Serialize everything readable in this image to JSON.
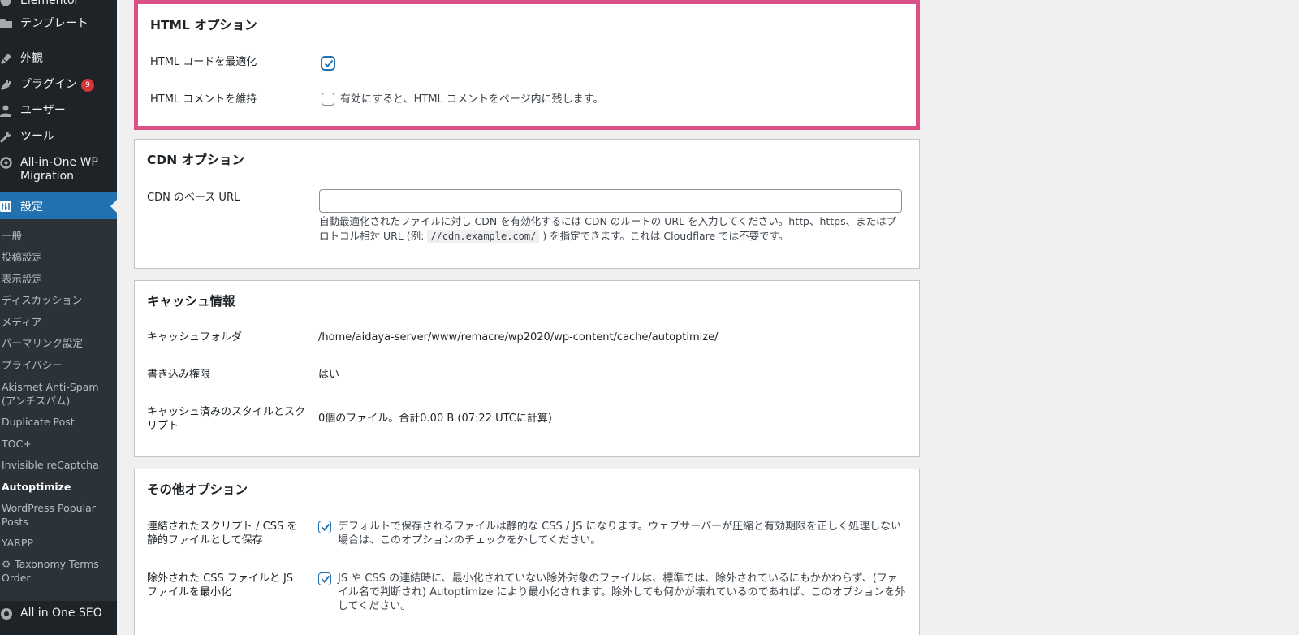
{
  "sidebar": {
    "items": [
      {
        "label": "Elementor",
        "icon": "elementor-icon"
      },
      {
        "label": "テンプレート",
        "icon": "folder-icon"
      },
      {
        "label": "外観",
        "icon": "paintbrush-icon"
      },
      {
        "label": "プラグイン",
        "icon": "plugin-icon",
        "badge": "9"
      },
      {
        "label": "ユーザー",
        "icon": "user-icon"
      },
      {
        "label": "ツール",
        "icon": "wrench-icon"
      },
      {
        "label": "All-in-One WP Migration",
        "icon": "migration-icon"
      }
    ],
    "current": {
      "label": "設定",
      "icon": "settings-icon"
    },
    "submenu": [
      {
        "label": "一般"
      },
      {
        "label": "投稿設定"
      },
      {
        "label": "表示設定"
      },
      {
        "label": "ディスカッション"
      },
      {
        "label": "メディア"
      },
      {
        "label": "パーマリンク設定"
      },
      {
        "label": "プライバシー"
      },
      {
        "label": "Akismet Anti-Spam (アンチスパム)"
      },
      {
        "label": "Duplicate Post"
      },
      {
        "label": "TOC+"
      },
      {
        "label": "Invisible reCaptcha"
      },
      {
        "label": "Autoptimize",
        "current": true
      },
      {
        "label": "WordPress Popular Posts"
      },
      {
        "label": "YARPP"
      },
      {
        "label": "Taxonomy Terms Order",
        "icon": "gear-icon"
      }
    ],
    "bottom": {
      "label": "All in One SEO",
      "icon": "aioseo-icon"
    }
  },
  "html_options": {
    "title": "HTML オプション",
    "minify_label": "HTML コードを最適化",
    "minify_checked": true,
    "keep_comments_label": "HTML コメントを維持",
    "keep_comments_checked": false,
    "keep_comments_desc": "有効にすると、HTML コメントをページ内に残します。"
  },
  "cdn_options": {
    "title": "CDN オプション",
    "base_url_label": "CDN のベース URL",
    "base_url_value": "",
    "help_before": "自動最適化されたファイルに対し CDN を有効化するには CDN のルートの URL を入力してください。http、https、またはプロトコル相対 URL (例: ",
    "help_code": "//cdn.example.com/",
    "help_after": " ) を指定できます。これは Cloudflare では不要です。"
  },
  "cache_info": {
    "title": "キャッシュ情報",
    "folder_label": "キャッシュフォルダ",
    "folder_value": "/home/aidaya-server/www/remacre/wp2020/wp-content/cache/autoptimize/",
    "writable_label": "書き込み権限",
    "writable_value": "はい",
    "cached_label": "キャッシュ済みのスタイルとスクリプト",
    "cached_value": "0個のファイル。合計0.00 B (07:22 UTCに計算)"
  },
  "misc_options": {
    "title": "その他オプション",
    "static_label": "連結されたスクリプト / CSS を静的ファイルとして保存",
    "static_checked": true,
    "static_desc": "デフォルトで保存されるファイルは静的な CSS / JS になります。ウェブサーバーが圧縮と有効期限を正しく処理しない場合は、このオプションのチェックを外してください。",
    "minify_excluded_label": "除外された CSS ファイルと JS ファイルを最小化",
    "minify_excluded_checked": true,
    "minify_excluded_desc": "JS や CSS の連結時に、最小化されていない除外対象のファイルは、標準では、除外されているにもかかわらず、(ファイル名で判断され) Autoptimize により最小化されます。除外しても何かが壊れているのであれば、このオプションを外してください。"
  },
  "colors": {
    "sidebar_bg": "#1d2327",
    "submenu_bg": "#2c3338",
    "accent": "#2271b1",
    "badge": "#d63638",
    "highlight_border": "#d94f86"
  }
}
